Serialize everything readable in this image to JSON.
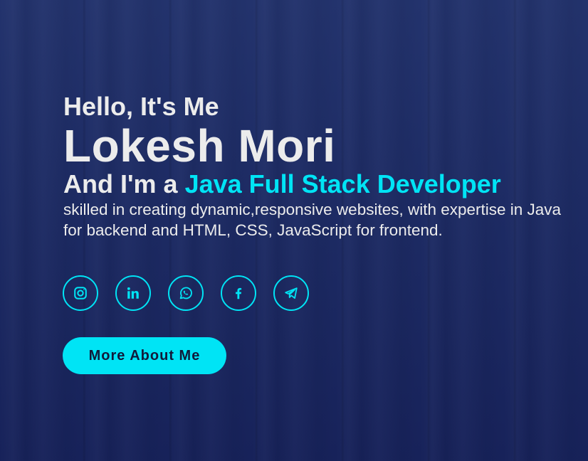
{
  "hero": {
    "greeting": "Hello, It's Me",
    "name": "Lokesh Mori",
    "role_prefix": "And I'm a ",
    "role_highlight": "Java Full Stack Developer",
    "description": "skilled in creating dynamic,responsive websites, with expertise in Java for backend and HTML, CSS, JavaScript for frontend."
  },
  "socials": [
    {
      "icon": "instagram-icon"
    },
    {
      "icon": "linkedin-icon"
    },
    {
      "icon": "whatsapp-icon"
    },
    {
      "icon": "facebook-icon"
    },
    {
      "icon": "telegram-icon"
    }
  ],
  "cta": {
    "label": "More About Me"
  },
  "colors": {
    "accent": "#00e4f5",
    "background": "#1b2a63",
    "text": "#ececec",
    "button_text": "#111a3a"
  }
}
